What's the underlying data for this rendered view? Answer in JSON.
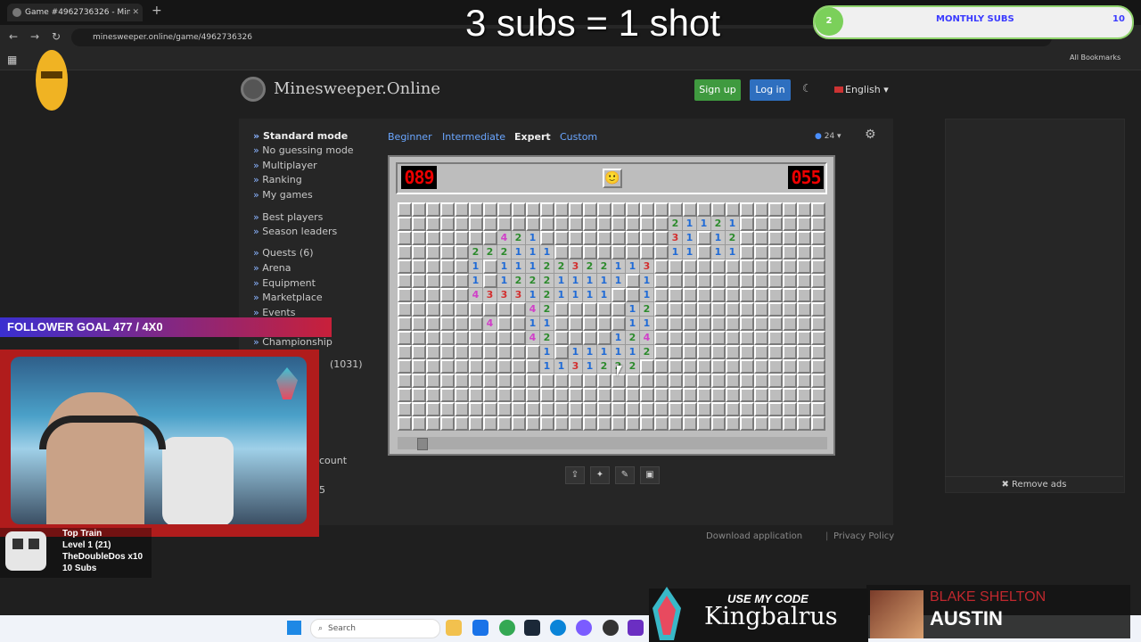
{
  "browser": {
    "tab_title": "Game #4962736326 - Minesw",
    "url": "minesweeper.online/game/4962736326",
    "bookmarks_label": "All Bookmarks"
  },
  "overlay": {
    "headline": "3 subs = 1 shot",
    "subs_count": "2",
    "subs_label": "MONTHLY SUBS",
    "subs_goal": "10",
    "follower_goal": "FOLLOWER GOAL 477 / 4X0"
  },
  "site": {
    "name": "Minesweeper.Online",
    "signup": "Sign up",
    "login": "Log in",
    "language": "English"
  },
  "sidebar": {
    "items": [
      "Standard mode",
      "No guessing mode",
      "Multiplayer",
      "Ranking",
      "My games",
      "Best players",
      "Season leaders",
      "Quests (6)",
      "Arena",
      "Equipment",
      "Marketplace",
      "Events",
      "Championship",
      "(1031)",
      "count",
      "5"
    ]
  },
  "modes": {
    "beginner": "Beginner",
    "intermediate": "Intermediate",
    "expert": "Expert",
    "custom": "Custom"
  },
  "game": {
    "count_select": "24",
    "mines_left": "089",
    "timer": "055",
    "cols": 30,
    "rows": 16,
    "open_cells": [
      [
        2,
        7,
        "4"
      ],
      [
        2,
        8,
        "2"
      ],
      [
        2,
        9,
        "1"
      ],
      [
        1,
        19,
        "2"
      ],
      [
        1,
        20,
        "1"
      ],
      [
        1,
        21,
        "1"
      ],
      [
        1,
        22,
        "2"
      ],
      [
        1,
        23,
        "1"
      ],
      [
        2,
        19,
        "3"
      ],
      [
        2,
        20,
        "1"
      ],
      [
        2,
        22,
        "1"
      ],
      [
        2,
        23,
        "2"
      ],
      [
        3,
        5,
        "2"
      ],
      [
        3,
        6,
        "2"
      ],
      [
        3,
        7,
        "2"
      ],
      [
        3,
        8,
        "1"
      ],
      [
        3,
        9,
        "1"
      ],
      [
        3,
        10,
        "1"
      ],
      [
        3,
        19,
        "1"
      ],
      [
        3,
        20,
        "1"
      ],
      [
        3,
        22,
        "1"
      ],
      [
        3,
        23,
        "1"
      ],
      [
        4,
        5,
        "1"
      ],
      [
        4,
        7,
        "1"
      ],
      [
        4,
        8,
        "1"
      ],
      [
        4,
        9,
        "1"
      ],
      [
        4,
        10,
        "2"
      ],
      [
        4,
        11,
        "2"
      ],
      [
        4,
        12,
        "3"
      ],
      [
        4,
        13,
        "2"
      ],
      [
        4,
        14,
        "2"
      ],
      [
        4,
        15,
        "1"
      ],
      [
        4,
        16,
        "1"
      ],
      [
        4,
        17,
        "3"
      ],
      [
        5,
        5,
        "1"
      ],
      [
        5,
        7,
        "1"
      ],
      [
        5,
        8,
        "2"
      ],
      [
        5,
        9,
        "2"
      ],
      [
        5,
        10,
        "2"
      ],
      [
        5,
        11,
        "1"
      ],
      [
        5,
        12,
        "1"
      ],
      [
        5,
        13,
        "1"
      ],
      [
        5,
        14,
        "1"
      ],
      [
        5,
        15,
        "1"
      ],
      [
        5,
        17,
        "1"
      ],
      [
        6,
        5,
        "4"
      ],
      [
        6,
        6,
        "3"
      ],
      [
        6,
        7,
        "3"
      ],
      [
        6,
        8,
        "3"
      ],
      [
        6,
        9,
        "1"
      ],
      [
        6,
        10,
        "2"
      ],
      [
        6,
        11,
        "1"
      ],
      [
        6,
        12,
        "1"
      ],
      [
        6,
        13,
        "1"
      ],
      [
        6,
        14,
        "1"
      ],
      [
        6,
        17,
        "1"
      ],
      [
        7,
        9,
        "4"
      ],
      [
        7,
        10,
        "2"
      ],
      [
        7,
        16,
        "1"
      ],
      [
        7,
        17,
        "2"
      ],
      [
        8,
        6,
        "4"
      ],
      [
        8,
        9,
        "1"
      ],
      [
        8,
        10,
        "1"
      ],
      [
        8,
        16,
        "1"
      ],
      [
        8,
        17,
        "1"
      ],
      [
        9,
        9,
        "4"
      ],
      [
        9,
        10,
        "2"
      ],
      [
        9,
        15,
        "1"
      ],
      [
        9,
        16,
        "2"
      ],
      [
        9,
        17,
        "4"
      ],
      [
        10,
        10,
        "1"
      ],
      [
        10,
        12,
        "1"
      ],
      [
        10,
        13,
        "1"
      ],
      [
        10,
        14,
        "1"
      ],
      [
        10,
        15,
        "1"
      ],
      [
        10,
        16,
        "1"
      ],
      [
        10,
        17,
        "2"
      ],
      [
        11,
        10,
        "1"
      ],
      [
        11,
        11,
        "1"
      ],
      [
        11,
        12,
        "3"
      ],
      [
        11,
        13,
        "1"
      ],
      [
        11,
        14,
        "2"
      ],
      [
        11,
        15,
        "2"
      ],
      [
        11,
        16,
        "2"
      ]
    ]
  },
  "ads": {
    "remove": "✖ Remove ads"
  },
  "footer": {
    "download": "Download application",
    "privacy": "Privacy Policy"
  },
  "stream": {
    "train_title": "Top Train",
    "train_level": "Level 1 (21)",
    "train_user": "TheDoubleDos x10",
    "train_subs": "10 Subs",
    "code_label": "USE MY CODE",
    "code_value": "Kingbalrus",
    "song_artist": "BLAKE SHELTON",
    "song_title": "AUSTIN"
  },
  "taskbar": {
    "search": "Search"
  }
}
